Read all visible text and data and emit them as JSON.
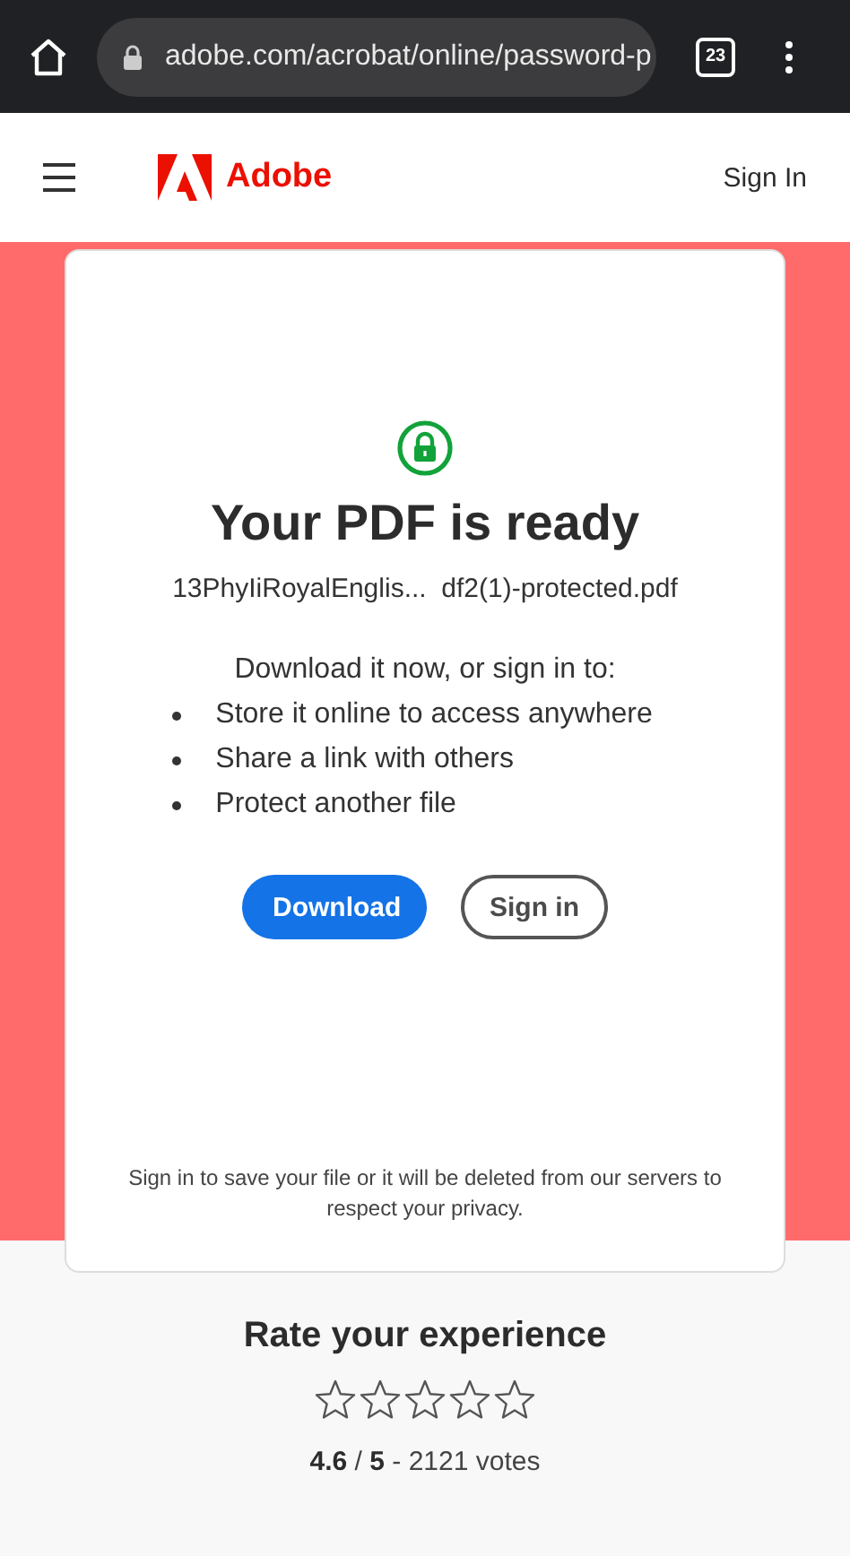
{
  "browser": {
    "url": "adobe.com/acrobat/online/password-p",
    "tab_count": "23"
  },
  "header": {
    "brand": "Adobe",
    "sign_in": "Sign In"
  },
  "card": {
    "title": "Your PDF is ready",
    "file_name": "13PhyIiRoyalEnglis...  df2(1)-protected.pdf",
    "prompt": "Download it now, or sign in to:",
    "bullets": [
      "Store it online to access anywhere",
      "Share a link with others",
      "Protect another file"
    ],
    "buttons": [
      {
        "label": "Download",
        "kind": "primary"
      },
      {
        "label": "Sign in",
        "kind": "secondary"
      }
    ],
    "notice": "Sign in to save your file or it will be deleted from our servers to respect your privacy."
  },
  "rating": {
    "title": "Rate your experience",
    "stars": 0,
    "summary": "**4.6** / **5** - 2121 votes"
  }
}
